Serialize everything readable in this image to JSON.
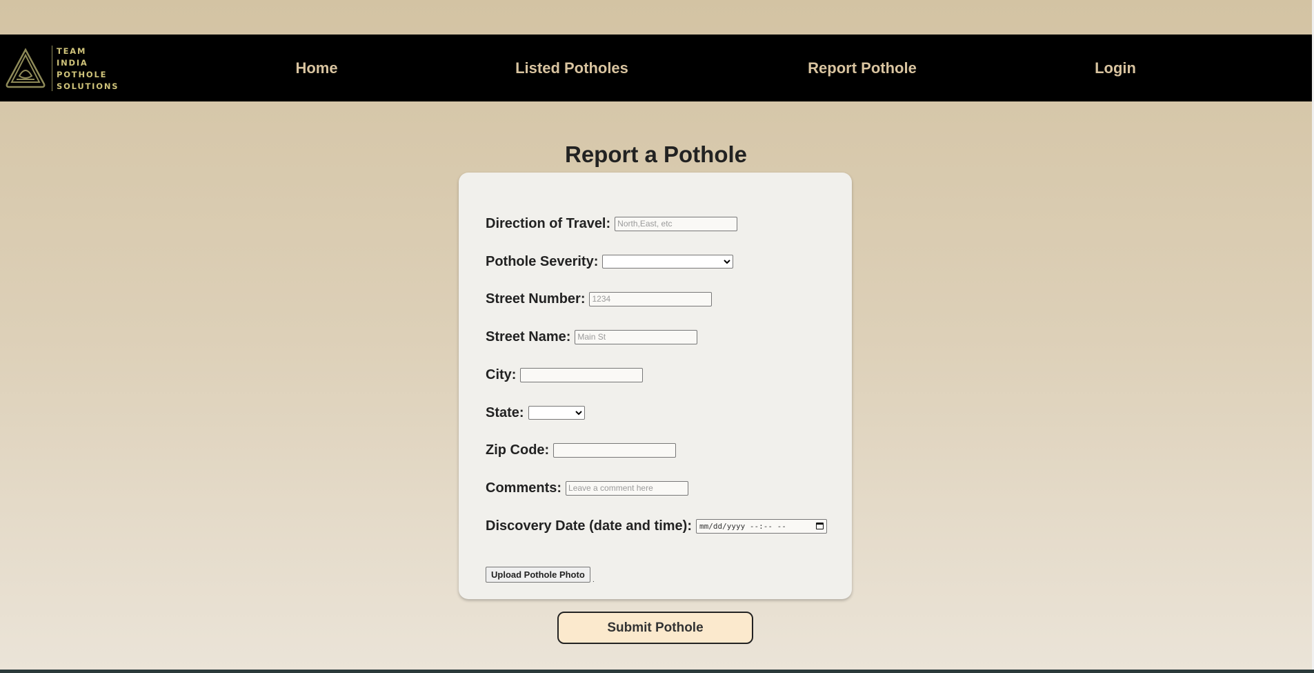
{
  "brand": {
    "logo_lines": [
      "TEAM",
      "INDIA",
      "POTHOLE",
      "SOLUTIONS"
    ]
  },
  "nav": {
    "home": "Home",
    "listed": "Listed Potholes",
    "report": "Report Pothole",
    "login": "Login"
  },
  "page": {
    "title": "Report a Pothole"
  },
  "form": {
    "direction": {
      "label": "Direction of Travel:",
      "placeholder": "North,East, etc"
    },
    "severity": {
      "label": "Pothole Severity:",
      "value": ""
    },
    "street_number": {
      "label": "Street Number:",
      "placeholder": "1234"
    },
    "street_name": {
      "label": "Street Name:",
      "placeholder": "Main St"
    },
    "city": {
      "label": "City:",
      "placeholder": ""
    },
    "state": {
      "label": "State:",
      "value": ""
    },
    "zip": {
      "label": "Zip Code:",
      "placeholder": ""
    },
    "comments": {
      "label": "Comments:",
      "placeholder": "Leave a comment here"
    },
    "discovery": {
      "label": "Discovery Date (date and time):",
      "value": "mm/dd/yyyy --:-- --"
    },
    "upload_label": "Upload Pothole Photo",
    "upload_suffix": "."
  },
  "submit_label": "Submit Pothole",
  "colors": {
    "navbar": "#000000",
    "nav_text": "#d9c4a0",
    "card": "#f1f0ec",
    "submit_bg": "#fbe9cd",
    "logo": "#cfc37a"
  }
}
